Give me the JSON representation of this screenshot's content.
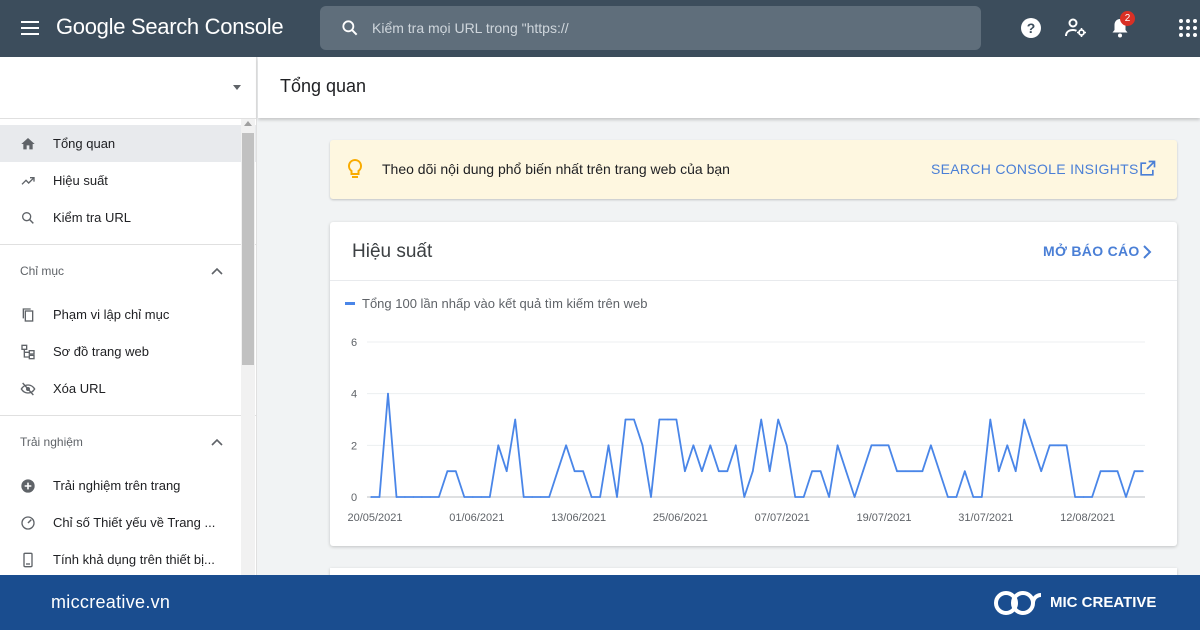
{
  "app": {
    "title": "Google Search Console",
    "search_placeholder": "Kiểm tra mọi URL trong \"https://",
    "notification_count": "2"
  },
  "sidebar": {
    "items": [
      {
        "label": "Tổng quan",
        "icon": "home-icon",
        "active": true
      },
      {
        "label": "Hiệu suất",
        "icon": "trending-up-icon"
      },
      {
        "label": "Kiểm tra URL",
        "icon": "search-icon"
      }
    ],
    "sections": [
      {
        "title": "Chỉ mục",
        "items": [
          {
            "label": "Phạm vi lập chỉ mục",
            "icon": "copy-icon"
          },
          {
            "label": "Sơ đồ trang web",
            "icon": "sitemap-icon"
          },
          {
            "label": "Xóa URL",
            "icon": "visibility-off-icon"
          }
        ]
      },
      {
        "title": "Trải nghiệm",
        "items": [
          {
            "label": "Trải nghiệm trên trang",
            "icon": "plus-circle-icon"
          },
          {
            "label": "Chỉ số Thiết yếu về Trang ...",
            "icon": "speed-icon"
          },
          {
            "label": "Tính khả dụng trên thiết bị...",
            "icon": "smartphone-icon"
          }
        ]
      }
    ]
  },
  "header": {
    "title": "Tổng quan"
  },
  "insights": {
    "text": "Theo dõi nội dung phổ biến nhất trên trang web của bạn",
    "link": "SEARCH CONSOLE INSIGHTS"
  },
  "performance": {
    "title": "Hiệu suất",
    "link": "MỞ BÁO CÁO",
    "legend": "Tổng 100 lần nhấp vào kết quả tìm kiếm trên web"
  },
  "chart_data": {
    "type": "line",
    "series": [
      {
        "name": "Tổng 100 lần nhấp vào kết quả tìm kiếm trên web",
        "color": "#4a86e8",
        "values": [
          0,
          0,
          4,
          0,
          0,
          0,
          0,
          0,
          0,
          1,
          1,
          0,
          0,
          0,
          0,
          2,
          1,
          3,
          0,
          0,
          0,
          0,
          1,
          2,
          1,
          1,
          0,
          0,
          2,
          0,
          3,
          3,
          2,
          0,
          3,
          3,
          3,
          1,
          2,
          1,
          2,
          1,
          1,
          2,
          0,
          1,
          3,
          1,
          3,
          2,
          0,
          0,
          1,
          1,
          0,
          2,
          1,
          0,
          1,
          2,
          2,
          2,
          1,
          1,
          1,
          1,
          2,
          1,
          0,
          0,
          1,
          0,
          0,
          3,
          1,
          2,
          1,
          3,
          2,
          1,
          2,
          2,
          2,
          0,
          0,
          0,
          1,
          1,
          1,
          0,
          1,
          1
        ]
      }
    ],
    "x_tick_labels": [
      "20/05/2021",
      "01/06/2021",
      "13/06/2021",
      "25/06/2021",
      "07/07/2021",
      "19/07/2021",
      "31/07/2021",
      "12/08/2021"
    ],
    "x_tick_positions": [
      0,
      12,
      24,
      36,
      48,
      60,
      72,
      84
    ],
    "y_ticks": [
      0,
      2,
      4,
      6
    ],
    "ylim": [
      0,
      6
    ],
    "grid": true
  },
  "footer": {
    "site": "miccreative.vn",
    "brand": "MIC CREATIVE"
  }
}
